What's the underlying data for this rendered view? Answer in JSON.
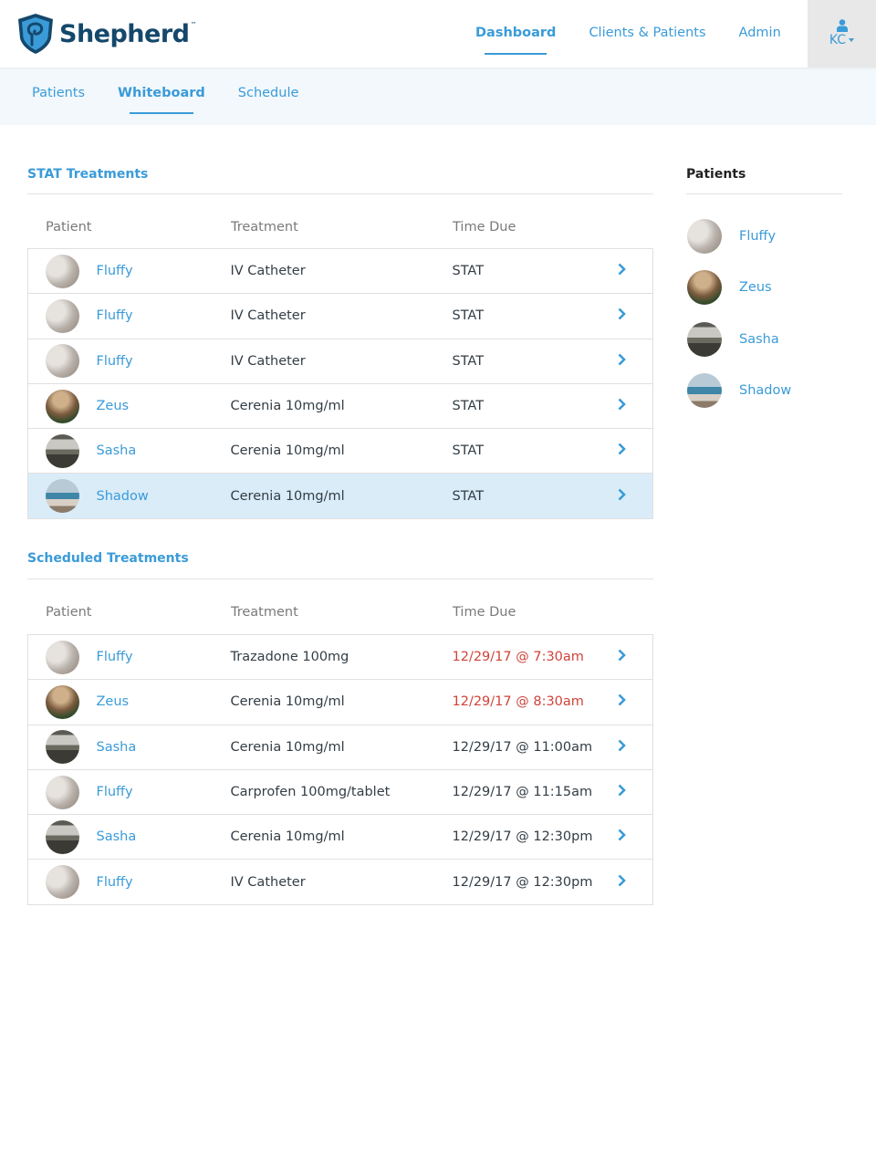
{
  "app": {
    "brand": "Shepherd",
    "trademark": "™"
  },
  "colors": {
    "accent": "#3a9bd8",
    "brand_dark": "#14486b",
    "overdue": "#d0433a",
    "highlight_row": "#d9ecf8",
    "subnav_bg": "#f2f8fc"
  },
  "main_nav": [
    {
      "label": "Dashboard",
      "active": true
    },
    {
      "label": "Clients & Patients",
      "active": false
    },
    {
      "label": "Admin",
      "active": false
    }
  ],
  "user": {
    "initials": "KC",
    "icon": "user-icon"
  },
  "sub_nav": [
    {
      "label": "Patients",
      "active": false
    },
    {
      "label": "Whiteboard",
      "active": true
    },
    {
      "label": "Schedule",
      "active": false
    }
  ],
  "stat": {
    "title": "STAT Treatments",
    "columns": [
      "Patient",
      "Treatment",
      "Time Due"
    ],
    "rows": [
      {
        "patient": "Fluffy",
        "treatment": "IV Catheter",
        "time": "STAT"
      },
      {
        "patient": "Fluffy",
        "treatment": "IV Catheter",
        "time": "STAT"
      },
      {
        "patient": "Fluffy",
        "treatment": "IV Catheter",
        "time": "STAT"
      },
      {
        "patient": "Zeus",
        "treatment": "Cerenia 10mg/ml",
        "time": "STAT"
      },
      {
        "patient": "Sasha",
        "treatment": "Cerenia 10mg/ml",
        "time": "STAT"
      },
      {
        "patient": "Shadow",
        "treatment": "Cerenia 10mg/ml",
        "time": "STAT",
        "highlighted": true
      }
    ]
  },
  "scheduled": {
    "title": "Scheduled Treatments",
    "columns": [
      "Patient",
      "Treatment",
      "Time Due"
    ],
    "rows": [
      {
        "patient": "Fluffy",
        "treatment": "Trazadone 100mg",
        "time": "12/29/17 @ 7:30am",
        "overdue": true
      },
      {
        "patient": "Zeus",
        "treatment": "Cerenia 10mg/ml",
        "time": "12/29/17 @ 8:30am",
        "overdue": true
      },
      {
        "patient": "Sasha",
        "treatment": "Cerenia 10mg/ml",
        "time": "12/29/17 @ 11:00am"
      },
      {
        "patient": "Fluffy",
        "treatment": "Carprofen 100mg/tablet",
        "time": "12/29/17 @ 11:15am"
      },
      {
        "patient": "Sasha",
        "treatment": "Cerenia 10mg/ml",
        "time": "12/29/17 @ 12:30pm"
      },
      {
        "patient": "Fluffy",
        "treatment": "IV Catheter",
        "time": "12/29/17 @ 12:30pm"
      }
    ]
  },
  "sidebar": {
    "title": "Patients",
    "patients": [
      "Fluffy",
      "Zeus",
      "Sasha",
      "Shadow"
    ]
  }
}
